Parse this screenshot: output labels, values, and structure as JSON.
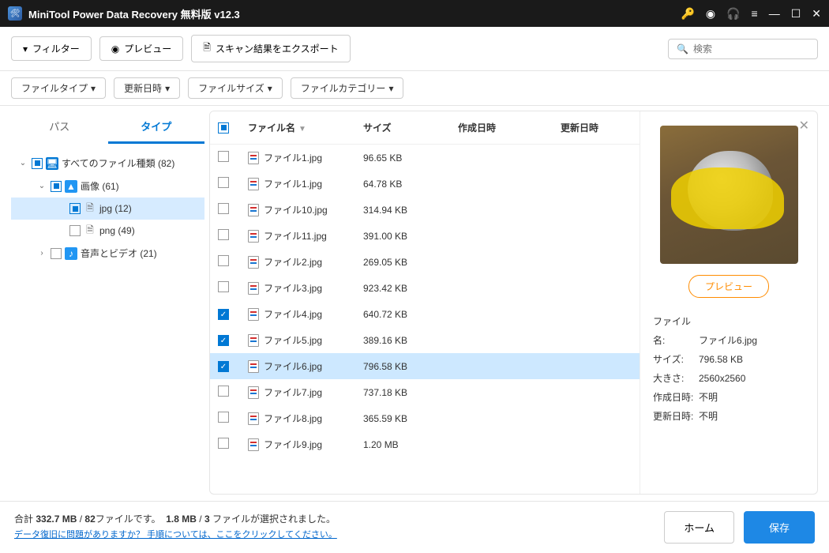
{
  "titlebar": {
    "title": "MiniTool Power Data Recovery 無料版 v12.3"
  },
  "toolbar": {
    "filter": "フィルター",
    "preview": "プレビュー",
    "export": "スキャン結果をエクスポート",
    "search_placeholder": "検索"
  },
  "filterbar": {
    "filetype": "ファイルタイプ",
    "modified": "更新日時",
    "filesize": "ファイルサイズ",
    "category": "ファイルカテゴリー"
  },
  "sidebar": {
    "tabs": {
      "path": "パス",
      "type": "タイプ"
    },
    "tree": {
      "all": "すべてのファイル種類 (82)",
      "images": "画像 (61)",
      "jpg": "jpg (12)",
      "png": "png (49)",
      "audio": "音声とビデオ (21)"
    }
  },
  "table": {
    "headers": {
      "name": "ファイル名",
      "size": "サイズ",
      "created": "作成日時",
      "modified": "更新日時"
    },
    "rows": [
      {
        "name": "ファイル1.jpg",
        "size": "96.65 KB",
        "checked": false,
        "selected": false
      },
      {
        "name": "ファイル1.jpg",
        "size": "64.78 KB",
        "checked": false,
        "selected": false
      },
      {
        "name": "ファイル10.jpg",
        "size": "314.94 KB",
        "checked": false,
        "selected": false
      },
      {
        "name": "ファイル11.jpg",
        "size": "391.00 KB",
        "checked": false,
        "selected": false
      },
      {
        "name": "ファイル2.jpg",
        "size": "269.05 KB",
        "checked": false,
        "selected": false
      },
      {
        "name": "ファイル3.jpg",
        "size": "923.42 KB",
        "checked": false,
        "selected": false
      },
      {
        "name": "ファイル4.jpg",
        "size": "640.72 KB",
        "checked": true,
        "selected": false
      },
      {
        "name": "ファイル5.jpg",
        "size": "389.16 KB",
        "checked": true,
        "selected": false
      },
      {
        "name": "ファイル6.jpg",
        "size": "796.58 KB",
        "checked": true,
        "selected": true
      },
      {
        "name": "ファイル7.jpg",
        "size": "737.18 KB",
        "checked": false,
        "selected": false
      },
      {
        "name": "ファイル8.jpg",
        "size": "365.59 KB",
        "checked": false,
        "selected": false
      },
      {
        "name": "ファイル9.jpg",
        "size": "1.20 MB",
        "checked": false,
        "selected": false
      }
    ]
  },
  "preview": {
    "button": "プレビュー",
    "labels": {
      "name": "ファイル名:",
      "size": "サイズ:",
      "dim": "大きさ:",
      "created": "作成日時:",
      "modified": "更新日時:"
    },
    "values": {
      "name": "ファイル6.jpg",
      "size": "796.58 KB",
      "dim": "2560x2560",
      "created": "不明",
      "modified": "不明"
    }
  },
  "footer": {
    "stats_prefix": "合計 ",
    "total_size": "332.7 MB",
    "sep1": " / ",
    "total_count": "82",
    "stats_mid1": "ファイルです。",
    "sel_size": "1.8 MB",
    "sep2": " / ",
    "sel_count": "3",
    "stats_mid2": " ファイルが選択されました。",
    "help_link": "データ復旧に問題がありますか？ 手順については、ここをクリックしてください。",
    "home": "ホーム",
    "save": "保存"
  }
}
